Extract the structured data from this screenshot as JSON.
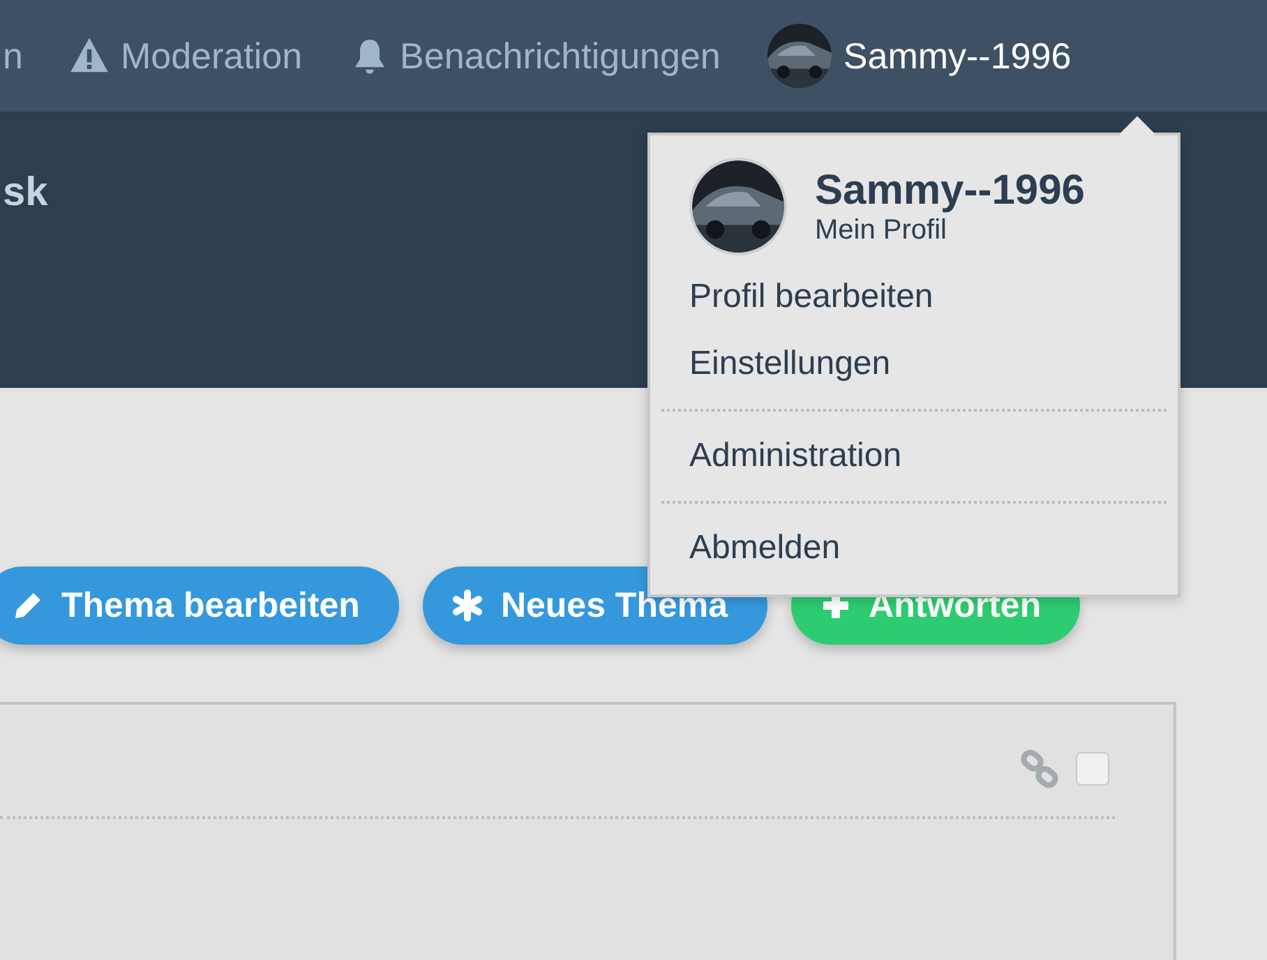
{
  "top_nav": {
    "items": [
      {
        "label": "n"
      },
      {
        "label": "Moderation"
      },
      {
        "label": "Benachrichtigungen"
      }
    ],
    "user": {
      "name": "Sammy--1996"
    }
  },
  "header": {
    "title": "sk"
  },
  "buttons": [
    {
      "label": "Thema bearbeiten",
      "kind": "primary"
    },
    {
      "label": "Neues Thema",
      "kind": "primary"
    },
    {
      "label": "Antworten",
      "kind": "success"
    }
  ],
  "post": {
    "checked": false
  },
  "user_menu": {
    "name": "Sammy--1996",
    "profile_link": "Mein Profil",
    "groups": [
      [
        "Profil bearbeiten",
        "Einstellungen"
      ],
      [
        "Administration"
      ],
      [
        "Abmelden"
      ]
    ]
  }
}
